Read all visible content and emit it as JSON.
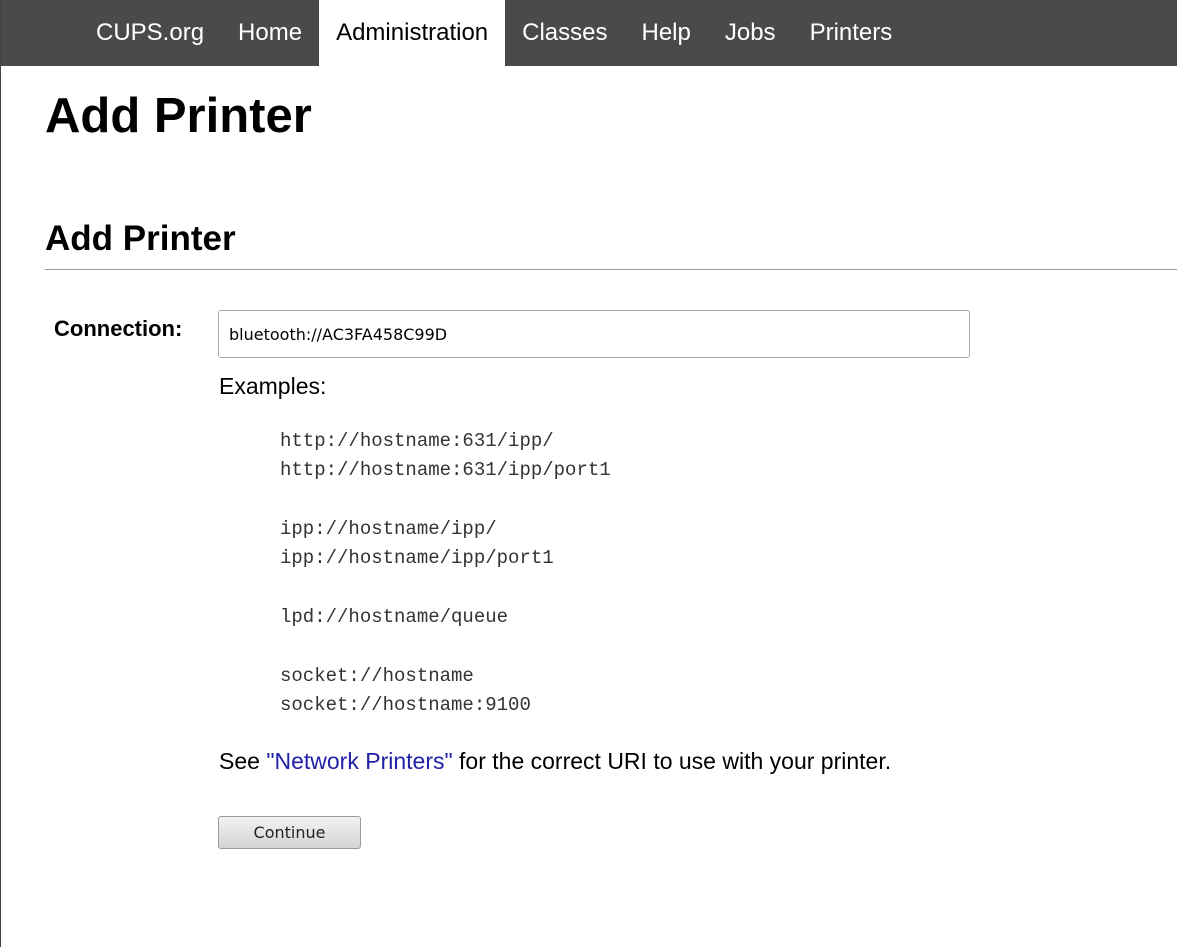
{
  "nav": {
    "items": [
      {
        "label": "CUPS.org",
        "active": false
      },
      {
        "label": "Home",
        "active": false
      },
      {
        "label": "Administration",
        "active": true
      },
      {
        "label": "Classes",
        "active": false
      },
      {
        "label": "Help",
        "active": false
      },
      {
        "label": "Jobs",
        "active": false
      },
      {
        "label": "Printers",
        "active": false
      }
    ]
  },
  "page": {
    "title": "Add Printer",
    "subtitle": "Add Printer"
  },
  "form": {
    "connection_label": "Connection:",
    "connection_value": "bluetooth://AC3FA458C99D",
    "examples_label": "Examples:",
    "example_groups": [
      [
        "http://hostname:631/ipp/",
        "http://hostname:631/ipp/port1"
      ],
      [
        "ipp://hostname/ipp/",
        "ipp://hostname/ipp/port1"
      ],
      [
        "lpd://hostname/queue"
      ],
      [
        "socket://hostname",
        "socket://hostname:9100"
      ]
    ],
    "note_prefix": "See ",
    "note_link": "\"Network Printers\"",
    "note_suffix": " for the correct URI to use with your printer.",
    "continue_label": "Continue"
  },
  "colors": {
    "navbar_bg": "#4a4a4a",
    "link": "#2020a8"
  }
}
